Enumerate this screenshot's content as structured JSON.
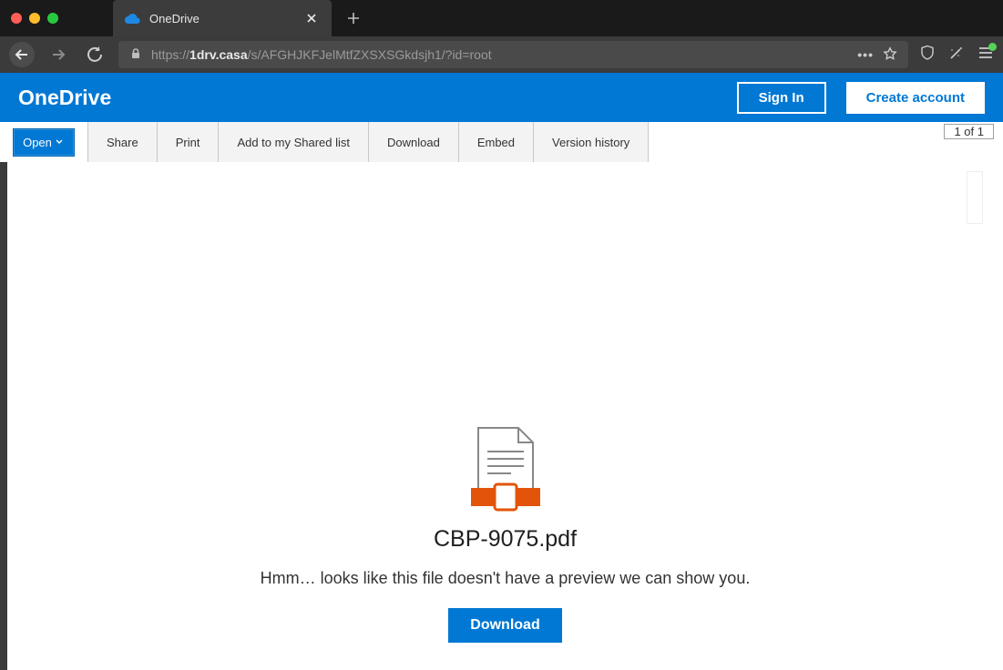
{
  "browser": {
    "tab_title": "OneDrive",
    "url_protocol": "https://",
    "url_host": "1drv.casa",
    "url_path": "/s/AFGHJKFJelMtfZXSXSGkdsjh1/?id=root"
  },
  "header": {
    "app_name": "OneDrive",
    "sign_in": "Sign In",
    "create_account": "Create account"
  },
  "toolbar": {
    "open": "Open",
    "share": "Share",
    "print": "Print",
    "add_shared": "Add to my Shared list",
    "download": "Download",
    "embed": "Embed",
    "version_history": "Version history",
    "page_counter": "1 of 1"
  },
  "preview": {
    "filename": "CBP-9075.pdf",
    "message": "Hmm… looks like this file doesn't have a preview we can show you.",
    "download": "Download"
  }
}
